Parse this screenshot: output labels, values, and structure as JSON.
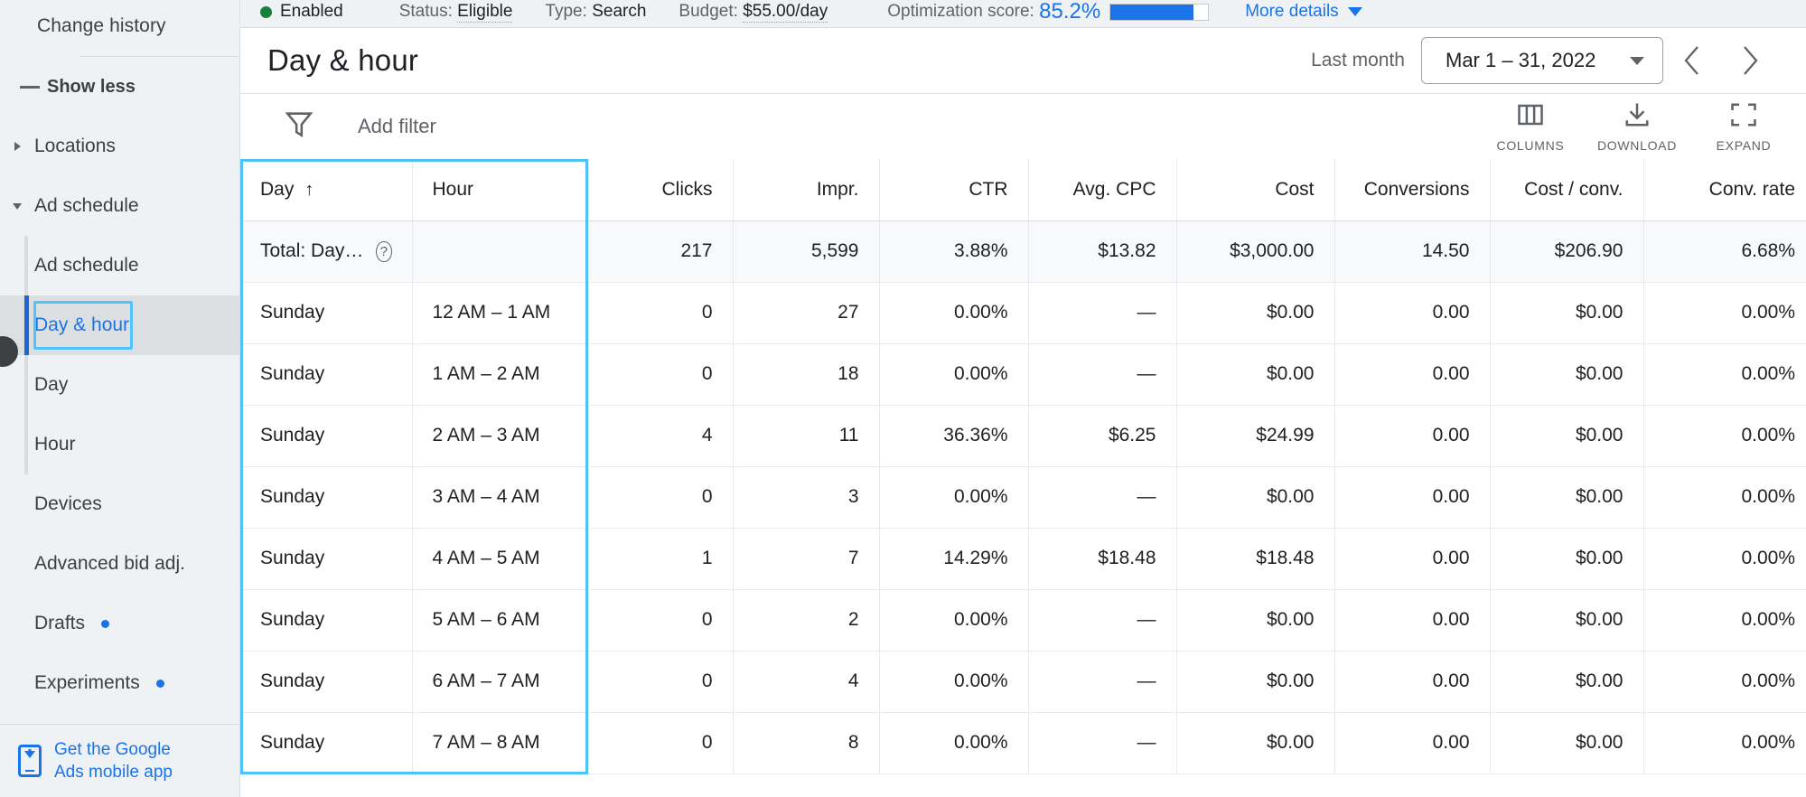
{
  "status_bar": {
    "state": "Enabled",
    "status_label": "Status:",
    "status_value": "Eligible",
    "type_label": "Type:",
    "type_value": "Search",
    "budget_label": "Budget:",
    "budget_value": "$55.00/day",
    "optimization_label": "Optimization score:",
    "optimization_value": "85.2%",
    "optimization_percent": 85.2,
    "more_details": "More details",
    "enabled_color": "#188038",
    "accent_color": "#1a73e8"
  },
  "sidebar": {
    "change_history": "Change history",
    "show_less": "Show less",
    "locations": "Locations",
    "ad_schedule_group": "Ad schedule",
    "items": [
      {
        "label": "Ad schedule",
        "selected": false,
        "dot": false
      },
      {
        "label": "Day & hour",
        "selected": true,
        "dot": false
      },
      {
        "label": "Day",
        "selected": false,
        "dot": false
      },
      {
        "label": "Hour",
        "selected": false,
        "dot": false
      }
    ],
    "others": [
      {
        "label": "Devices",
        "dot": false
      },
      {
        "label": "Advanced bid adj.",
        "dot": false
      },
      {
        "label": "Drafts",
        "dot": true
      },
      {
        "label": "Experiments",
        "dot": true
      }
    ],
    "mobile_app_line1": "Get the Google",
    "mobile_app_line2": "Ads mobile app"
  },
  "header": {
    "title": "Day & hour",
    "last_month_label": "Last month",
    "date_range": "Mar 1 – 31, 2022"
  },
  "toolbar": {
    "add_filter": "Add filter",
    "columns": "COLUMNS",
    "download": "DOWNLOAD",
    "expand": "EXPAND"
  },
  "table": {
    "columns": [
      {
        "key": "day",
        "label": "Day",
        "align": "txt",
        "sorted": "asc",
        "sort_glyph": "↑"
      },
      {
        "key": "hour",
        "label": "Hour",
        "align": "txt"
      },
      {
        "key": "clicks",
        "label": "Clicks",
        "align": "num"
      },
      {
        "key": "impr",
        "label": "Impr.",
        "align": "num"
      },
      {
        "key": "ctr",
        "label": "CTR",
        "align": "num"
      },
      {
        "key": "avg_cpc",
        "label": "Avg. CPC",
        "align": "num"
      },
      {
        "key": "cost",
        "label": "Cost",
        "align": "num"
      },
      {
        "key": "conversions",
        "label": "Conversions",
        "align": "num"
      },
      {
        "key": "cost_per_conv",
        "label": "Cost / conv.",
        "align": "num"
      },
      {
        "key": "conv_rate",
        "label": "Conv. rate",
        "align": "num"
      }
    ],
    "total_row": {
      "label": "Total: Day…",
      "hour": "",
      "clicks": "217",
      "impr": "5,599",
      "ctr": "3.88%",
      "avg_cpc": "$13.82",
      "cost": "$3,000.00",
      "conversions": "14.50",
      "cost_per_conv": "$206.90",
      "conv_rate": "6.68%"
    },
    "rows": [
      {
        "day": "Sunday",
        "hour": "12 AM – 1 AM",
        "clicks": "0",
        "impr": "27",
        "ctr": "0.00%",
        "avg_cpc": "—",
        "cost": "$0.00",
        "conversions": "0.00",
        "cost_per_conv": "$0.00",
        "conv_rate": "0.00%"
      },
      {
        "day": "Sunday",
        "hour": "1 AM – 2 AM",
        "clicks": "0",
        "impr": "18",
        "ctr": "0.00%",
        "avg_cpc": "—",
        "cost": "$0.00",
        "conversions": "0.00",
        "cost_per_conv": "$0.00",
        "conv_rate": "0.00%"
      },
      {
        "day": "Sunday",
        "hour": "2 AM – 3 AM",
        "clicks": "4",
        "impr": "11",
        "ctr": "36.36%",
        "avg_cpc": "$6.25",
        "cost": "$24.99",
        "conversions": "0.00",
        "cost_per_conv": "$0.00",
        "conv_rate": "0.00%"
      },
      {
        "day": "Sunday",
        "hour": "3 AM – 4 AM",
        "clicks": "0",
        "impr": "3",
        "ctr": "0.00%",
        "avg_cpc": "—",
        "cost": "$0.00",
        "conversions": "0.00",
        "cost_per_conv": "$0.00",
        "conv_rate": "0.00%"
      },
      {
        "day": "Sunday",
        "hour": "4 AM – 5 AM",
        "clicks": "1",
        "impr": "7",
        "ctr": "14.29%",
        "avg_cpc": "$18.48",
        "cost": "$18.48",
        "conversions": "0.00",
        "cost_per_conv": "$0.00",
        "conv_rate": "0.00%"
      },
      {
        "day": "Sunday",
        "hour": "5 AM – 6 AM",
        "clicks": "0",
        "impr": "2",
        "ctr": "0.00%",
        "avg_cpc": "—",
        "cost": "$0.00",
        "conversions": "0.00",
        "cost_per_conv": "$0.00",
        "conv_rate": "0.00%"
      },
      {
        "day": "Sunday",
        "hour": "6 AM – 7 AM",
        "clicks": "0",
        "impr": "4",
        "ctr": "0.00%",
        "avg_cpc": "—",
        "cost": "$0.00",
        "conversions": "0.00",
        "cost_per_conv": "$0.00",
        "conv_rate": "0.00%"
      },
      {
        "day": "Sunday",
        "hour": "7 AM – 8 AM",
        "clicks": "0",
        "impr": "8",
        "ctr": "0.00%",
        "avg_cpc": "—",
        "cost": "$0.00",
        "conversions": "0.00",
        "cost_per_conv": "$0.00",
        "conv_rate": "0.00%"
      }
    ]
  }
}
